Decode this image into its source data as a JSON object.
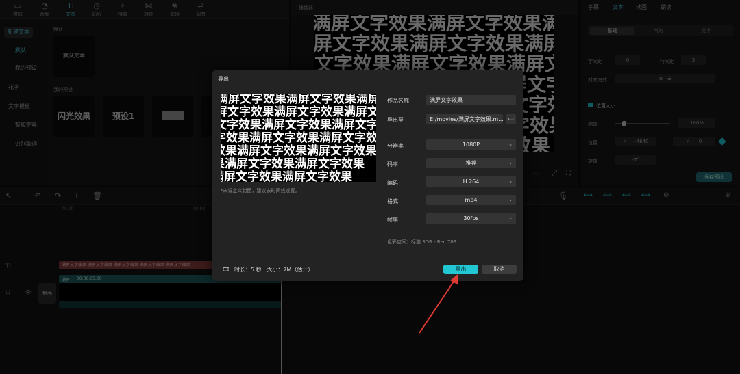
{
  "toolbar": {
    "tabs": [
      {
        "label": "媒体",
        "icon": "▭"
      },
      {
        "label": "音频",
        "icon": "◔"
      },
      {
        "label": "文本",
        "icon": "TI"
      },
      {
        "label": "贴纸",
        "icon": "◷"
      },
      {
        "label": "特效",
        "icon": "✧"
      },
      {
        "label": "转场",
        "icon": "⋈"
      },
      {
        "label": "滤镜",
        "icon": "❀"
      },
      {
        "label": "调节",
        "icon": "⇌"
      }
    ]
  },
  "text_panel": {
    "nav": [
      "新建文本",
      "默认",
      "我的预设",
      "花字",
      "文字模板",
      "智能字幕",
      "识别歌词"
    ],
    "default_section": "默认",
    "default_tile": "默认文本",
    "preset_section": "我的预设",
    "preset_tiles": [
      "闪光效果",
      "预设1"
    ]
  },
  "player": {
    "title": "播放器",
    "preview_text": "满屏文字效果"
  },
  "inspector": {
    "tabs": [
      "字幕",
      "文本",
      "动画",
      "朗读"
    ],
    "subtabs": [
      "基础",
      "气泡",
      "花字"
    ],
    "line_height_label": "字间距",
    "line_height_value": "0",
    "spacing_label": "行间距",
    "spacing_value": "3",
    "align_label": "对齐方式",
    "position_size_label": "位置大小",
    "scale_label": "缩放",
    "scale_value": "100%",
    "position_label": "位置",
    "pos_x_label": "X",
    "pos_x_value": "-4640",
    "pos_y_label": "Y",
    "pos_y_value": "0",
    "rotate_label": "旋转",
    "rotate_value": "-7°",
    "save_preset": "保存预设"
  },
  "timeline": {
    "ticks": [
      "00:00",
      "00:03"
    ],
    "text_clip": "满屏文字效果 满屏文字效果 满屏文字效果 满屏文字效果 满屏文字效果",
    "video_clip_label": "满屏",
    "video_clip_time": "00:00:05:00",
    "cover_label": "封面"
  },
  "export_dialog": {
    "title": "导出",
    "preview_text": "满屏文字效果",
    "hint": "*未设定义封面，建议去时间线设置。",
    "name_label": "作品名称",
    "name_value": "满屏文字效果",
    "path_label": "导出至",
    "path_value": "E:/movies/满屏文字效果.m...",
    "resolution_label": "分辨率",
    "resolution_value": "1080P",
    "bitrate_label": "码率",
    "bitrate_value": "推荐",
    "codec_label": "编码",
    "codec_value": "H.264",
    "format_label": "格式",
    "format_value": "mp4",
    "fps_label": "帧率",
    "fps_value": "30fps",
    "color_space": "色彩空间：标准 SDR - Rec.709",
    "footer_info": "时长：5 秒 | 大小：7M（估计）",
    "export_button": "导出",
    "cancel_button": "取消"
  },
  "colors": {
    "accent": "#22c7d4",
    "annotation_arrow": "#e03a35"
  }
}
